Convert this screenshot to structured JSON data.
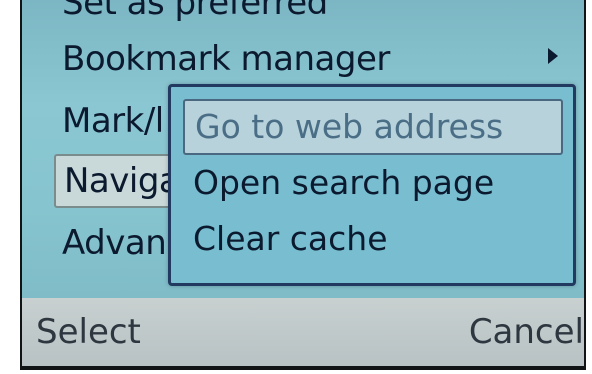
{
  "menu": {
    "items": [
      {
        "label": "Set as preferred"
      },
      {
        "label": "Bookmark manager"
      },
      {
        "label": "Mark/l"
      },
      {
        "label": "Naviga"
      },
      {
        "label": "Advan"
      }
    ]
  },
  "submenu": {
    "items": [
      {
        "label": "Go to web address",
        "highlighted": true
      },
      {
        "label": "Open search page"
      },
      {
        "label": "Clear cache"
      }
    ]
  },
  "softkeys": {
    "left_label": "Select",
    "right_label": "Cancel"
  },
  "icons": {
    "submenu_arrow": "chevron-right-icon"
  },
  "colors": {
    "menu_background": "#86c4cf",
    "submenu_border": "#233a60",
    "softkey_background": "#c0c8ca",
    "text": "#0b1a2e"
  }
}
